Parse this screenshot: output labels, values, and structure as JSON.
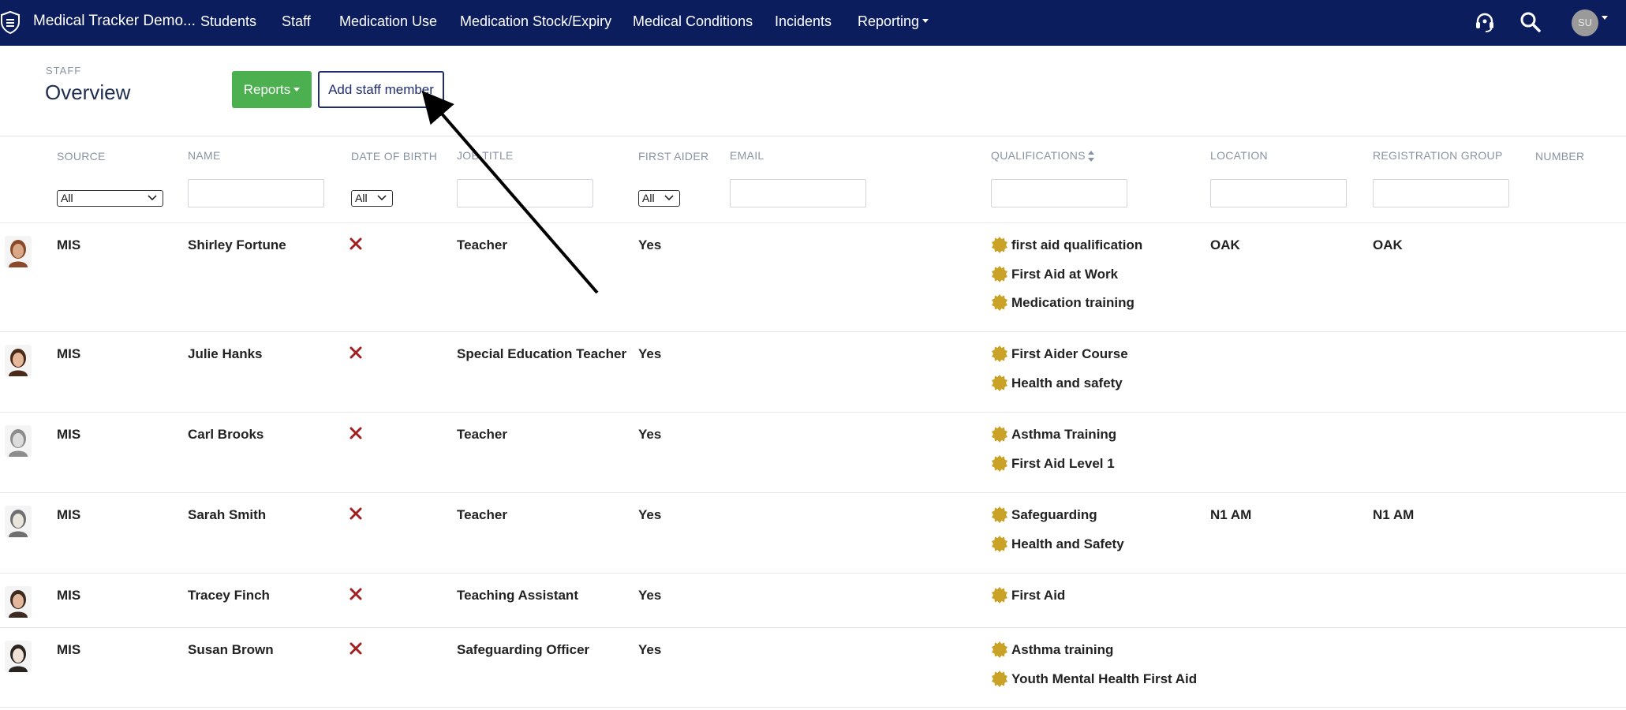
{
  "nav": {
    "brand": "Medical Tracker Demo...",
    "items": [
      "Students",
      "Staff",
      "Medication Use",
      "Medication Stock/Expiry",
      "Medical Conditions",
      "Incidents",
      "Reporting"
    ],
    "avatar_initials": "SU",
    "icons": [
      "shield-icon",
      "headset-icon",
      "search-icon",
      "user-avatar"
    ]
  },
  "header": {
    "section": "STAFF",
    "title": "Overview",
    "reports_label": "Reports",
    "add_label": "Add staff member"
  },
  "columns": [
    "SOURCE",
    "NAME",
    "DATE OF BIRTH",
    "JOB TITLE",
    "FIRST AIDER",
    "EMAIL",
    "QUALIFICATIONS",
    "LOCATION",
    "REGISTRATION GROUP",
    "NUMBER"
  ],
  "filters": {
    "source": "All",
    "dob": "All",
    "first_aider": "All"
  },
  "rows": [
    {
      "source": "MIS",
      "name": "Shirley Fortune",
      "job": "Teacher",
      "first_aider": "Yes",
      "qualifications": [
        "first aid qualification",
        "First Aid at Work",
        "Medication training"
      ],
      "location": "OAK",
      "reg_group": "OAK"
    },
    {
      "source": "MIS",
      "name": "Julie Hanks",
      "job": "Special Education Teacher",
      "first_aider": "Yes",
      "qualifications": [
        "First Aider Course",
        "Health and safety"
      ],
      "location": "",
      "reg_group": ""
    },
    {
      "source": "MIS",
      "name": "Carl Brooks",
      "job": "Teacher",
      "first_aider": "Yes",
      "qualifications": [
        "Asthma Training",
        "First Aid Level 1"
      ],
      "location": "",
      "reg_group": ""
    },
    {
      "source": "MIS",
      "name": "Sarah Smith",
      "job": "Teacher",
      "first_aider": "Yes",
      "qualifications": [
        "Safeguarding",
        "Health and Safety"
      ],
      "location": "N1 AM",
      "reg_group": "N1 AM"
    },
    {
      "source": "MIS",
      "name": "Tracey Finch",
      "job": "Teaching Assistant",
      "first_aider": "Yes",
      "qualifications": [
        "First Aid"
      ],
      "location": "",
      "reg_group": ""
    },
    {
      "source": "MIS",
      "name": "Susan Brown",
      "job": "Safeguarding Officer",
      "first_aider": "Yes",
      "qualifications": [
        "Asthma training",
        "Youth Mental Health First Aid"
      ],
      "location": "",
      "reg_group": ""
    }
  ],
  "colors": {
    "navbar": "#0c1d5e",
    "reports_button": "#4caf50",
    "badge_gold": "#c9a227",
    "cross_red": "#a31f1f"
  }
}
